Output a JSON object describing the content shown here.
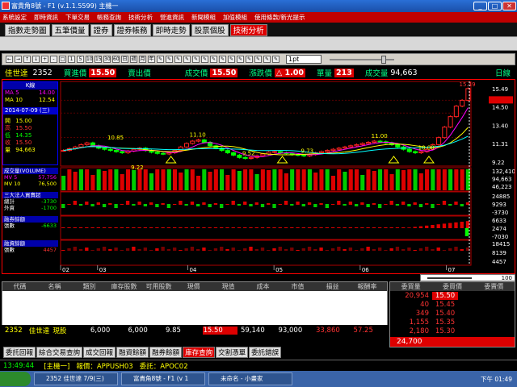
{
  "window": {
    "title": "富貴角8號 - F1  (v.1.1.5599) 主機一",
    "min": "_",
    "max": "□",
    "close": "✕"
  },
  "menu": [
    "系統設定",
    "即時資訊",
    "下單交易",
    "帳務查詢",
    "技術分析",
    "營進資訊",
    "新聞模組",
    "加值模組",
    "使用條款/新光提示"
  ],
  "tabs": [
    "指數走勢圖",
    "五筆價量",
    "證券",
    "證券帳務",
    "即時走勢",
    "股票個股",
    "技術分析"
  ],
  "toolbar": {
    "period_select": "1pt",
    "buttons": [
      "←",
      "→",
      "↑",
      "↓",
      "+",
      "-",
      "□",
      "1",
      "5",
      "10",
      "15",
      "30",
      "60",
      "日",
      "週",
      "月",
      "年",
      "✎",
      "✎",
      "✎",
      "✎",
      "✎",
      "✎",
      "✎",
      "✎",
      "✎",
      "✎",
      "✎",
      "✎",
      "✎",
      "✎"
    ]
  },
  "quote": {
    "name": "佳世達",
    "code": "2352",
    "buy_label": "買進價",
    "buy": "15.50",
    "sell_label": "賣出價",
    "deal_label": "成交價",
    "deal": "15.50",
    "chg_label": "漲跌價",
    "chg": "△ 1.00",
    "vol_label": "單量",
    "vol": "213",
    "total_label": "成交量",
    "total": "94,663",
    "period": "日線"
  },
  "info_panel": {
    "header": "K線",
    "ma_rows": [
      {
        "k": "MA",
        "p": "5",
        "v": "14.00"
      },
      {
        "k": "MA",
        "p": "10",
        "v": "12.54"
      }
    ],
    "date": "2014-07-09 (三)",
    "rows": [
      {
        "k": "開",
        "v": "15.00"
      },
      {
        "k": "高",
        "v": "15.50"
      },
      {
        "k": "低",
        "v": "14.35"
      },
      {
        "k": "收",
        "v": "15.50"
      },
      {
        "k": "量",
        "v": "94,663"
      }
    ]
  },
  "vol_panel": {
    "header": "成交量(VOLUME)",
    "rows": [
      {
        "k": "MV 5",
        "v": "57,756"
      },
      {
        "k": "MV 10",
        "v": "76,500"
      }
    ]
  },
  "inst_panel": {
    "header": "三大法人買賣超",
    "rows": [
      {
        "k": "總計",
        "v": "-3730"
      },
      {
        "k": "外資",
        "v": "-1700"
      }
    ]
  },
  "margin_panel": {
    "header": "融券餘額",
    "rows": [
      {
        "k": "張數",
        "v": "-6633"
      }
    ]
  },
  "short_panel": {
    "header": "融資餘額",
    "rows": [
      {
        "k": "張數",
        "v": "4457"
      }
    ]
  },
  "price_axis": [
    "15.49",
    "14.50",
    "13.40",
    "11.31",
    "9.22"
  ],
  "vol_axis": [
    "132,410",
    "94,663",
    "46,223"
  ],
  "inst_axis": [
    "24885",
    "9293",
    "-3730"
  ],
  "margin_axis": [
    "6633",
    "2474",
    "-7030"
  ],
  "short_axis": [
    "18415",
    "8139",
    "4457"
  ],
  "price_labels": [
    "10.85",
    "11.10",
    "9.52",
    "9.73",
    "11.00",
    "10.00",
    "9.22",
    "15.49"
  ],
  "month_labels": [
    "02",
    "03",
    "04",
    "05",
    "06",
    "07"
  ],
  "chart_zoom_value": "100",
  "table_headers": [
    "代碼",
    "名稱",
    "類別",
    "庫存股數",
    "可用股數",
    "現價",
    "現值",
    "成本",
    "市值",
    "損益",
    "報酬率"
  ],
  "table_row": [
    "2352",
    "佳世達",
    "現股",
    "6,000",
    "6,000",
    "9.85",
    "15.50",
    "59,140",
    "93,000",
    "33,860",
    "57.25"
  ],
  "book": {
    "headers": [
      "委買量",
      "委買價",
      "委賣價"
    ],
    "rows": [
      {
        "v": "20,954",
        "p": "15.50"
      },
      {
        "v": "40",
        "p": "15.45"
      },
      {
        "v": "349",
        "p": "15.40"
      },
      {
        "v": "1,155",
        "p": "15.35"
      },
      {
        "v": "2,180",
        "p": "15.30"
      }
    ],
    "total": "24,700"
  },
  "bottom_tabs": [
    "委託回報",
    "綜合交易查詢",
    "成交回報",
    "融資餘額",
    "融券餘額",
    "庫存查詢",
    "交割憑單",
    "委託錯誤"
  ],
  "status": {
    "time": "13:49:44",
    "host": "[主機一]",
    "report": "報價：APPUSH03",
    "order": "委託：APOC02"
  },
  "taskbar": {
    "items": [
      "2352 佳世達 7/9(三)",
      "富貴角8號 - F1 (v 1",
      "未命名 - 小畫家"
    ],
    "clock": "下午 01:49"
  },
  "chart_data": {
    "type": "candlestick",
    "ylim": [
      9.0,
      15.7
    ],
    "closes": [
      10.2,
      10.35,
      10.5,
      10.7,
      10.85,
      10.6,
      10.4,
      10.3,
      10.2,
      10.1,
      10.0,
      10.15,
      10.3,
      10.4,
      10.2,
      10.05,
      9.95,
      9.9,
      10.0,
      10.2,
      10.5,
      10.8,
      11.0,
      11.1,
      10.9,
      10.6,
      10.4,
      10.2,
      10.0,
      9.8,
      9.6,
      9.52,
      9.6,
      9.75,
      9.9,
      10.05,
      10.1,
      10.0,
      9.95,
      9.85,
      9.8,
      9.73,
      9.85,
      10.0,
      10.1,
      10.2,
      10.3,
      10.4,
      10.5,
      10.6,
      10.7,
      10.8,
      10.9,
      11.0,
      10.95,
      10.85,
      10.7,
      10.5,
      10.3,
      10.1,
      10.0,
      10.1,
      10.3,
      10.7,
      11.3,
      12.2,
      13.1,
      14.0,
      14.5,
      15.5
    ]
  }
}
